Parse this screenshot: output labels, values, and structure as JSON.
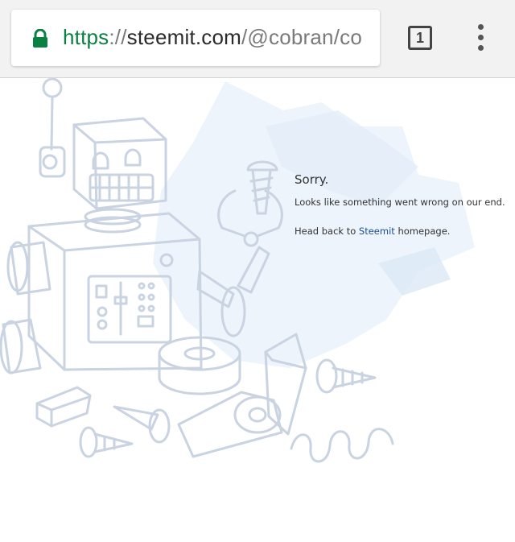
{
  "browser": {
    "url": {
      "scheme": "https",
      "separator": "://",
      "host": "steemit.com",
      "path": "/@cobran/co"
    },
    "tab_count": "1",
    "icons": {
      "lock": "lock-icon",
      "menu": "more-vert-icon"
    }
  },
  "error_page": {
    "title": "Sorry.",
    "message": "Looks like something went wrong on our end.",
    "back_prefix": "Head back to ",
    "back_link": "Steemit",
    "back_suffix": " homepage."
  },
  "colors": {
    "link": "#1a5099",
    "secure": "#0b8043",
    "sketch": "#c9d3e2",
    "splash": "#e8f2fb"
  }
}
